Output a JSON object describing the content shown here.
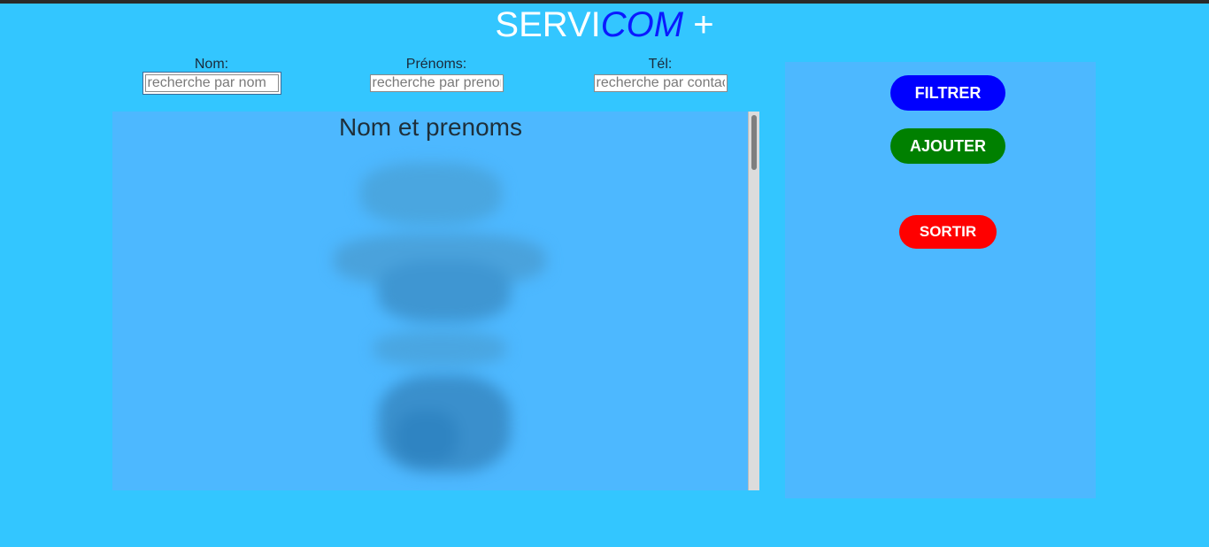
{
  "brand": {
    "part1": "SERVI",
    "part2": "COM",
    "part3": " +"
  },
  "filters": {
    "nom": {
      "label": "Nom:",
      "placeholder": "recherche par nom"
    },
    "prenoms": {
      "label": "Prénoms:",
      "placeholder": "recherche par prenom"
    },
    "tel": {
      "label": "Tél:",
      "placeholder": "recherche par contact"
    }
  },
  "list": {
    "title": "Nom et prenoms"
  },
  "actions": {
    "filter_label": "FILTRER",
    "add_label": "AJOUTER",
    "exit_label": "SORTIR"
  },
  "colors": {
    "background": "#33c6ff",
    "panel": "#4db8ff",
    "filter_button": "#0000ff",
    "add_button": "#008000",
    "exit_button": "#ff0000",
    "brand_accent": "#0a1aff"
  }
}
